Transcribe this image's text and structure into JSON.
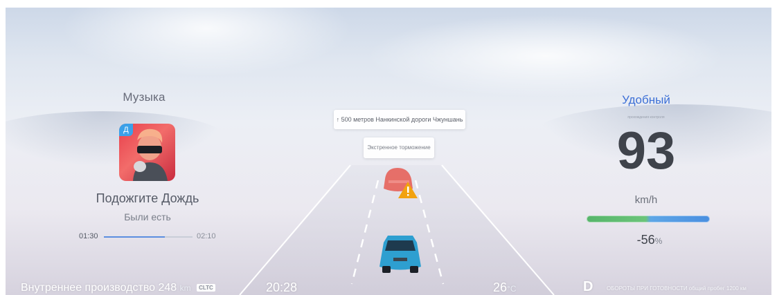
{
  "music": {
    "section_title": "Музыка",
    "badge": "Д",
    "song_title": "Подожгите Дождь",
    "artist": "Были есть",
    "elapsed": "01:30",
    "duration": "02:10",
    "progress": 0.69
  },
  "navigation": {
    "instruction": "↑ 500 метров Нанкинской дороги Чжуншань",
    "warning": "Экстренное торможение"
  },
  "drive": {
    "mode": "Удобный",
    "mode_subtitle": "прохождения контроля",
    "speed": "93",
    "speed_unit": "km/h",
    "power_percent": "-56",
    "percent_sign": "%"
  },
  "status_bar": {
    "range_label": "Внутреннее производство",
    "range_value": "248",
    "range_unit": "km",
    "range_standard": "CLTC",
    "clock": "20:28",
    "temperature": "26",
    "temperature_unit": "°C",
    "gear": "D",
    "info_text": "ОБОРОТЫ ПРИ ГОТОВНОСТИ общий пробег 1200 км"
  },
  "colors": {
    "accent_blue": "#3c6fd6",
    "lead_car": "#e5625a",
    "ego_car": "#2e9fd0",
    "warning": "#f2a20f"
  }
}
